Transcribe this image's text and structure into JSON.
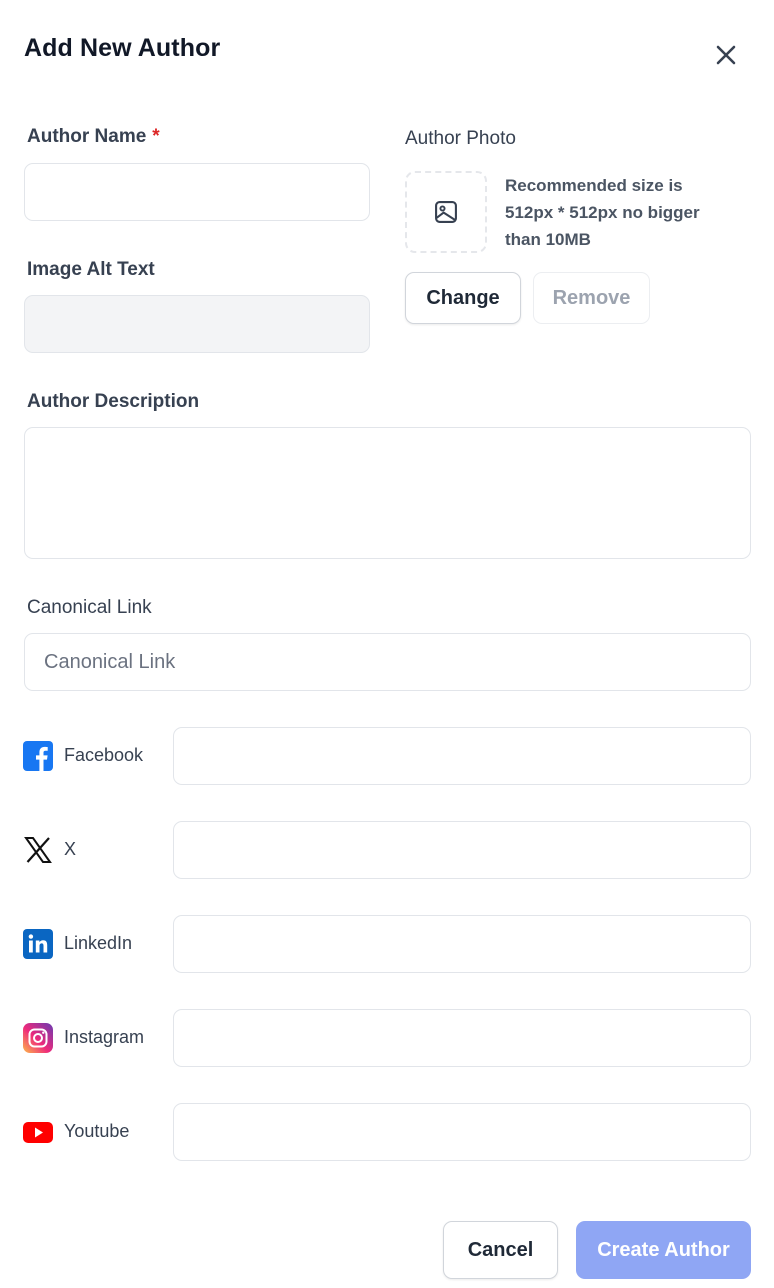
{
  "modal": {
    "title": "Add New Author",
    "close_icon": "close-icon"
  },
  "form": {
    "author_name": {
      "label": "Author Name",
      "required_marker": "*",
      "value": "",
      "placeholder": ""
    },
    "image_alt_text": {
      "label": "Image Alt Text",
      "value": "",
      "placeholder": ""
    },
    "author_photo": {
      "label": "Author Photo",
      "placeholder_icon": "image-icon",
      "hint": "Recommended size is 512px * 512px no bigger than 10MB",
      "change_label": "Change",
      "remove_label": "Remove"
    },
    "author_description": {
      "label": "Author Description",
      "value": "",
      "placeholder": ""
    },
    "canonical_link": {
      "label": "Canonical Link",
      "value": "",
      "placeholder": "Canonical Link"
    }
  },
  "socials": [
    {
      "label": "Facebook",
      "icon": "facebook-icon",
      "value": "",
      "color": "#1877f2"
    },
    {
      "label": "X",
      "icon": "x-icon",
      "value": "",
      "color": "#111111"
    },
    {
      "label": "LinkedIn",
      "icon": "linkedin-icon",
      "value": "",
      "color": "#0a66c2"
    },
    {
      "label": "Instagram",
      "icon": "instagram-icon",
      "value": "",
      "color": "#e1306c"
    },
    {
      "label": "Youtube",
      "icon": "youtube-icon",
      "value": "",
      "color": "#ff0000"
    }
  ],
  "footer": {
    "cancel_label": "Cancel",
    "create_label": "Create Author"
  },
  "colors": {
    "primary_disabled": "#8fa6f4",
    "required": "#dc2626"
  }
}
